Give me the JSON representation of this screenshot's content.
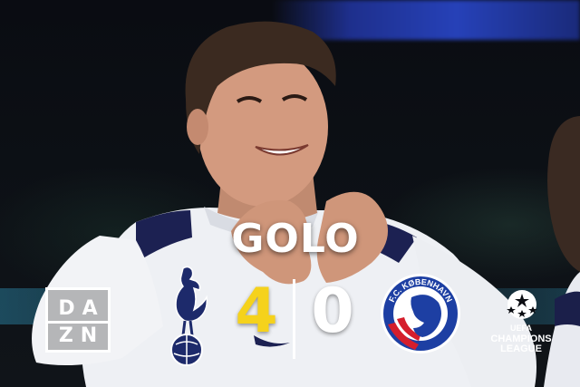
{
  "overlay": {
    "headline": "GOLO",
    "broadcaster_logo": {
      "icon": "dazn-logo",
      "row1": "DA",
      "row2": "ZN"
    },
    "home_team": {
      "icon": "tottenham-hotspur-crest",
      "score": "4"
    },
    "away_team": {
      "icon": "fc-kobenhavn-crest",
      "crest_text": "F.C. KØBENHAVN",
      "score": "0"
    },
    "competition": {
      "icon": "uefa-champions-league-logo",
      "line1": "UEFA",
      "line2": "CHAMPIONS",
      "line3": "LEAGUE"
    }
  },
  "colors": {
    "home_score": "#f5d21c",
    "away_score": "#ffffff",
    "kobenhavn_blue": "#1d3fa3",
    "kobenhavn_red": "#d51e2c"
  }
}
